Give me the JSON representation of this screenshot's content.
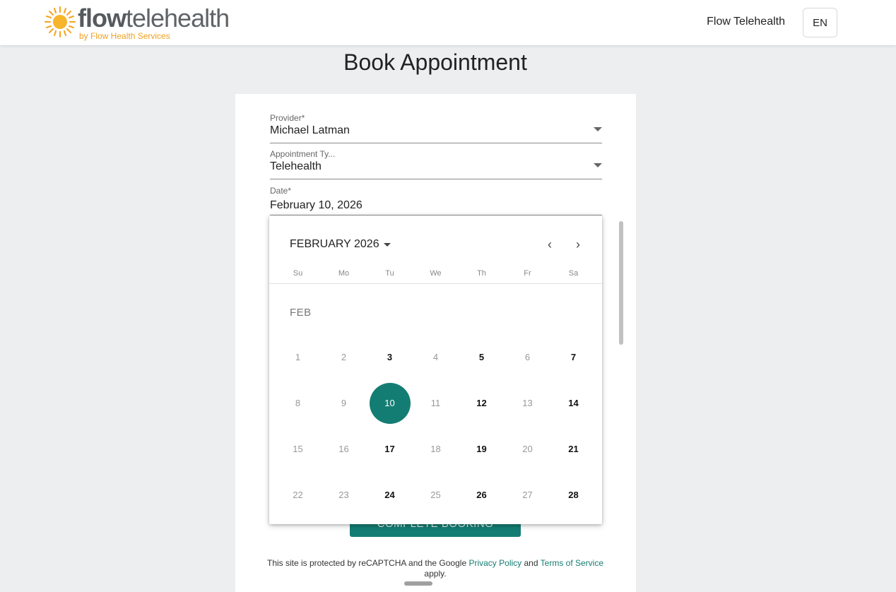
{
  "header": {
    "logo_word_1": "flow",
    "logo_word_2": "telehealth",
    "logo_sub": "by Flow Health Services",
    "nav_link": "Flow Telehealth",
    "lang": "EN"
  },
  "page": {
    "title": "Book Appointment"
  },
  "form": {
    "provider": {
      "label": "Provider*",
      "value": "Michael Latman"
    },
    "appointment_type": {
      "label": "Appointment Ty...",
      "value": "Telehealth"
    },
    "date": {
      "label": "Date*",
      "value": "February 10, 2026"
    },
    "complete_button": "COMPLETE BOOKING"
  },
  "recaptcha": {
    "text_1": "This site is protected by reCAPTCHA and the Google",
    "privacy": "Privacy Policy",
    "and": "and",
    "terms": "Terms of Service",
    "text_2": "apply."
  },
  "calendar": {
    "month_label": "FEBRUARY 2026",
    "prev_icon": "chevron-left-icon",
    "next_icon": "chevron-right-icon",
    "prev_glyph": "‹",
    "next_glyph": "›",
    "weekdays": [
      "Su",
      "Mo",
      "Tu",
      "We",
      "Th",
      "Fr",
      "Sa"
    ],
    "month_tag": "FEB",
    "weeks": [
      [
        {
          "d": "1",
          "s": "disabled"
        },
        {
          "d": "2",
          "s": "disabled"
        },
        {
          "d": "3",
          "s": "available"
        },
        {
          "d": "4",
          "s": "disabled"
        },
        {
          "d": "5",
          "s": "available"
        },
        {
          "d": "6",
          "s": "disabled"
        },
        {
          "d": "7",
          "s": "available"
        }
      ],
      [
        {
          "d": "8",
          "s": "disabled"
        },
        {
          "d": "9",
          "s": "disabled"
        },
        {
          "d": "10",
          "s": "selected"
        },
        {
          "d": "11",
          "s": "disabled"
        },
        {
          "d": "12",
          "s": "available"
        },
        {
          "d": "13",
          "s": "disabled"
        },
        {
          "d": "14",
          "s": "available"
        }
      ],
      [
        {
          "d": "15",
          "s": "disabled"
        },
        {
          "d": "16",
          "s": "disabled"
        },
        {
          "d": "17",
          "s": "available"
        },
        {
          "d": "18",
          "s": "disabled"
        },
        {
          "d": "19",
          "s": "available"
        },
        {
          "d": "20",
          "s": "disabled"
        },
        {
          "d": "21",
          "s": "available"
        }
      ],
      [
        {
          "d": "22",
          "s": "disabled"
        },
        {
          "d": "23",
          "s": "disabled"
        },
        {
          "d": "24",
          "s": "available"
        },
        {
          "d": "25",
          "s": "disabled"
        },
        {
          "d": "26",
          "s": "available"
        },
        {
          "d": "27",
          "s": "disabled"
        },
        {
          "d": "28",
          "s": "available"
        }
      ]
    ]
  },
  "colors": {
    "accent": "#147d73",
    "logo_orange": "#f0a020"
  }
}
